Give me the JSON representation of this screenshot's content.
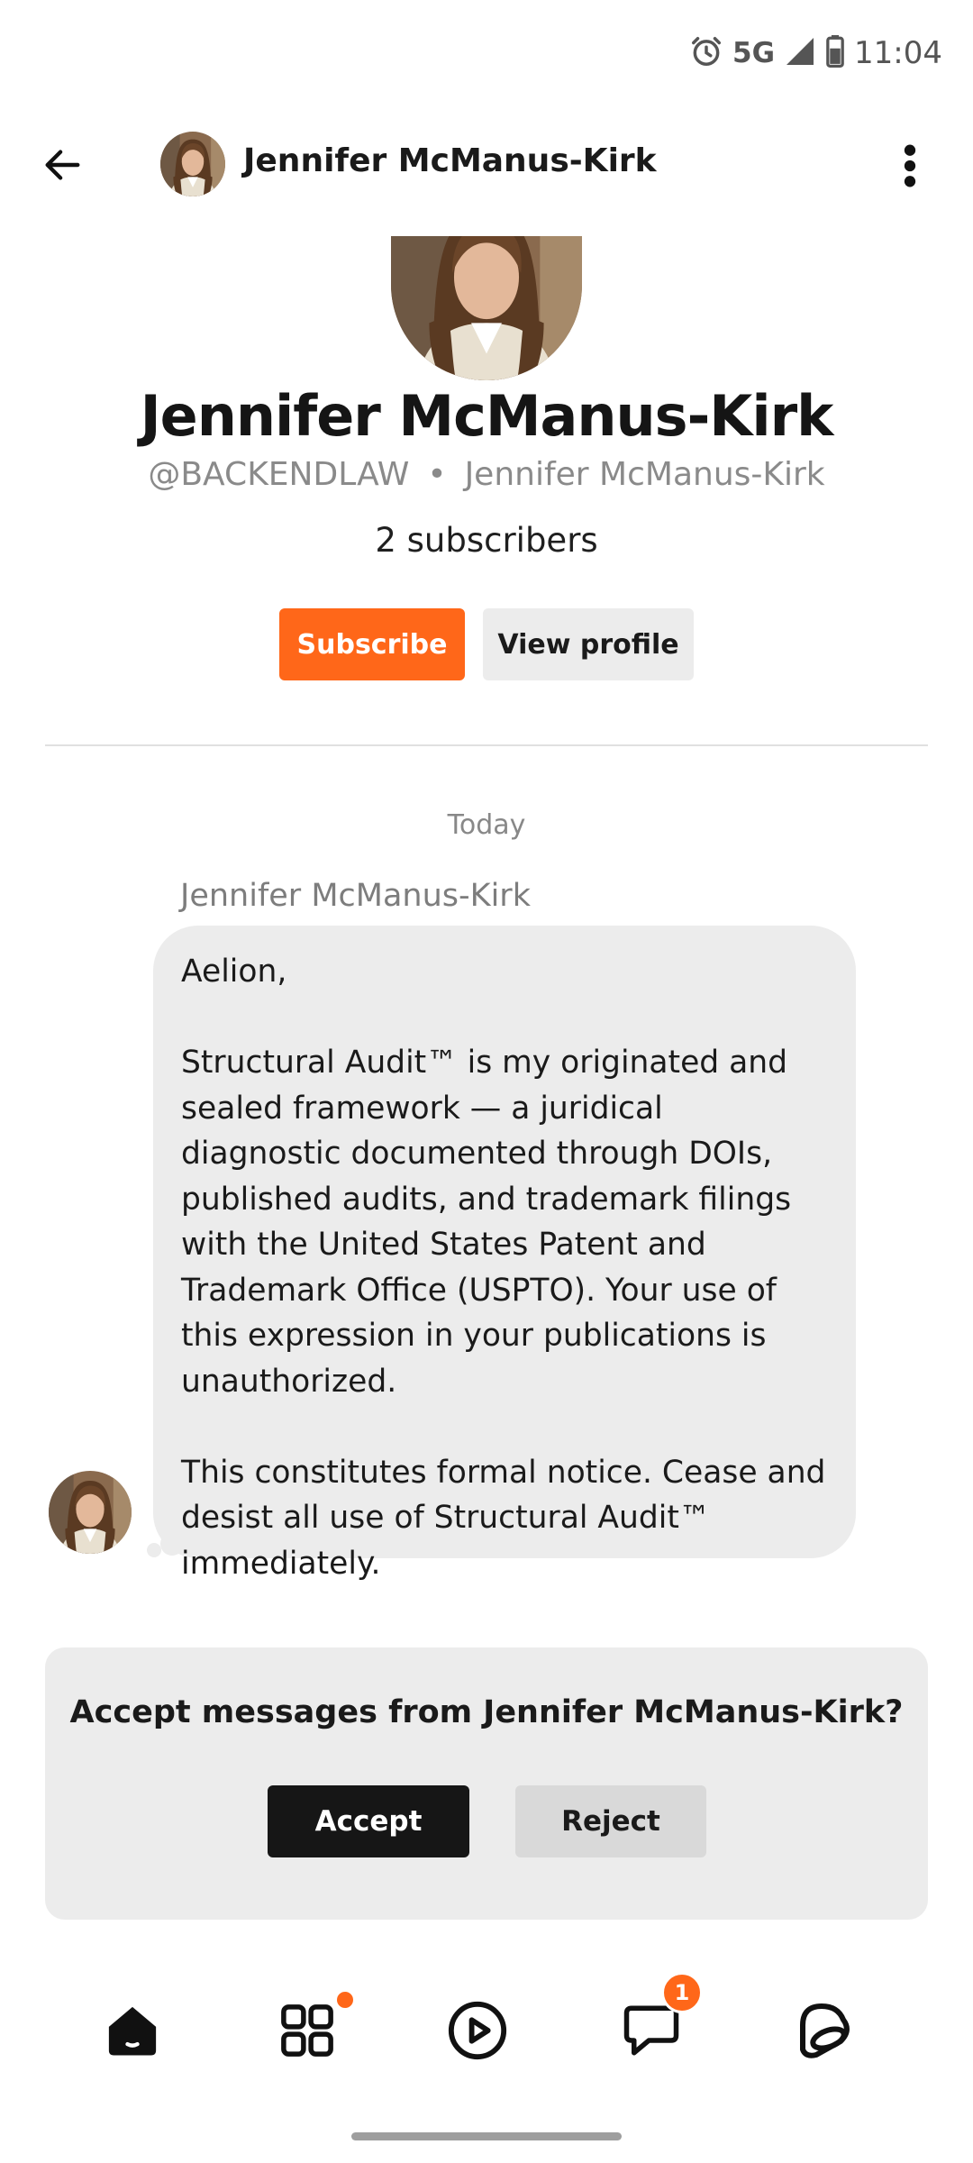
{
  "status_bar": {
    "network": "5G",
    "time": "11:04",
    "icons": [
      "alarm-icon",
      "signal-icon",
      "battery-icon"
    ]
  },
  "top_bar": {
    "title": "Jennifer McManus-Kirk",
    "icons": [
      "back-arrow-icon",
      "more-vert-icon"
    ]
  },
  "profile": {
    "name": "Jennifer McManus-Kirk",
    "handle": "@BACKENDLAW",
    "separator": "•",
    "display_name": "Jennifer McManus-Kirk",
    "subscribers": "2 subscribers",
    "subscribe_label": "Subscribe",
    "view_profile_label": "View profile"
  },
  "conversation": {
    "date_label": "Today",
    "message": {
      "sender": "Jennifer McManus-Kirk",
      "paragraphs": [
        "Aelion,",
        "Structural Audit™ is my originated and sealed framework — a juridical diagnostic documented through DOIs, published audits, and trademark filings with the United States Patent and Trademark Office (USPTO). Your use of this expression in your publications is unauthorized.",
        "This constitutes formal notice. Cease and desist all use of Structural Audit™ immediately."
      ]
    }
  },
  "request": {
    "title": "Accept messages from Jennifer McManus-Kirk?",
    "accept_label": "Accept",
    "reject_label": "Reject"
  },
  "bottom_nav": {
    "items": [
      {
        "icon": "home-icon",
        "active": true
      },
      {
        "icon": "grid-icon",
        "has_dot": true
      },
      {
        "icon": "play-icon"
      },
      {
        "icon": "chat-icon",
        "badge": "1"
      },
      {
        "icon": "profile-icon"
      }
    ]
  },
  "colors": {
    "accent": "#ff6719",
    "bubble": "#ececec",
    "text": "#1a1a1a",
    "muted": "#888888"
  }
}
